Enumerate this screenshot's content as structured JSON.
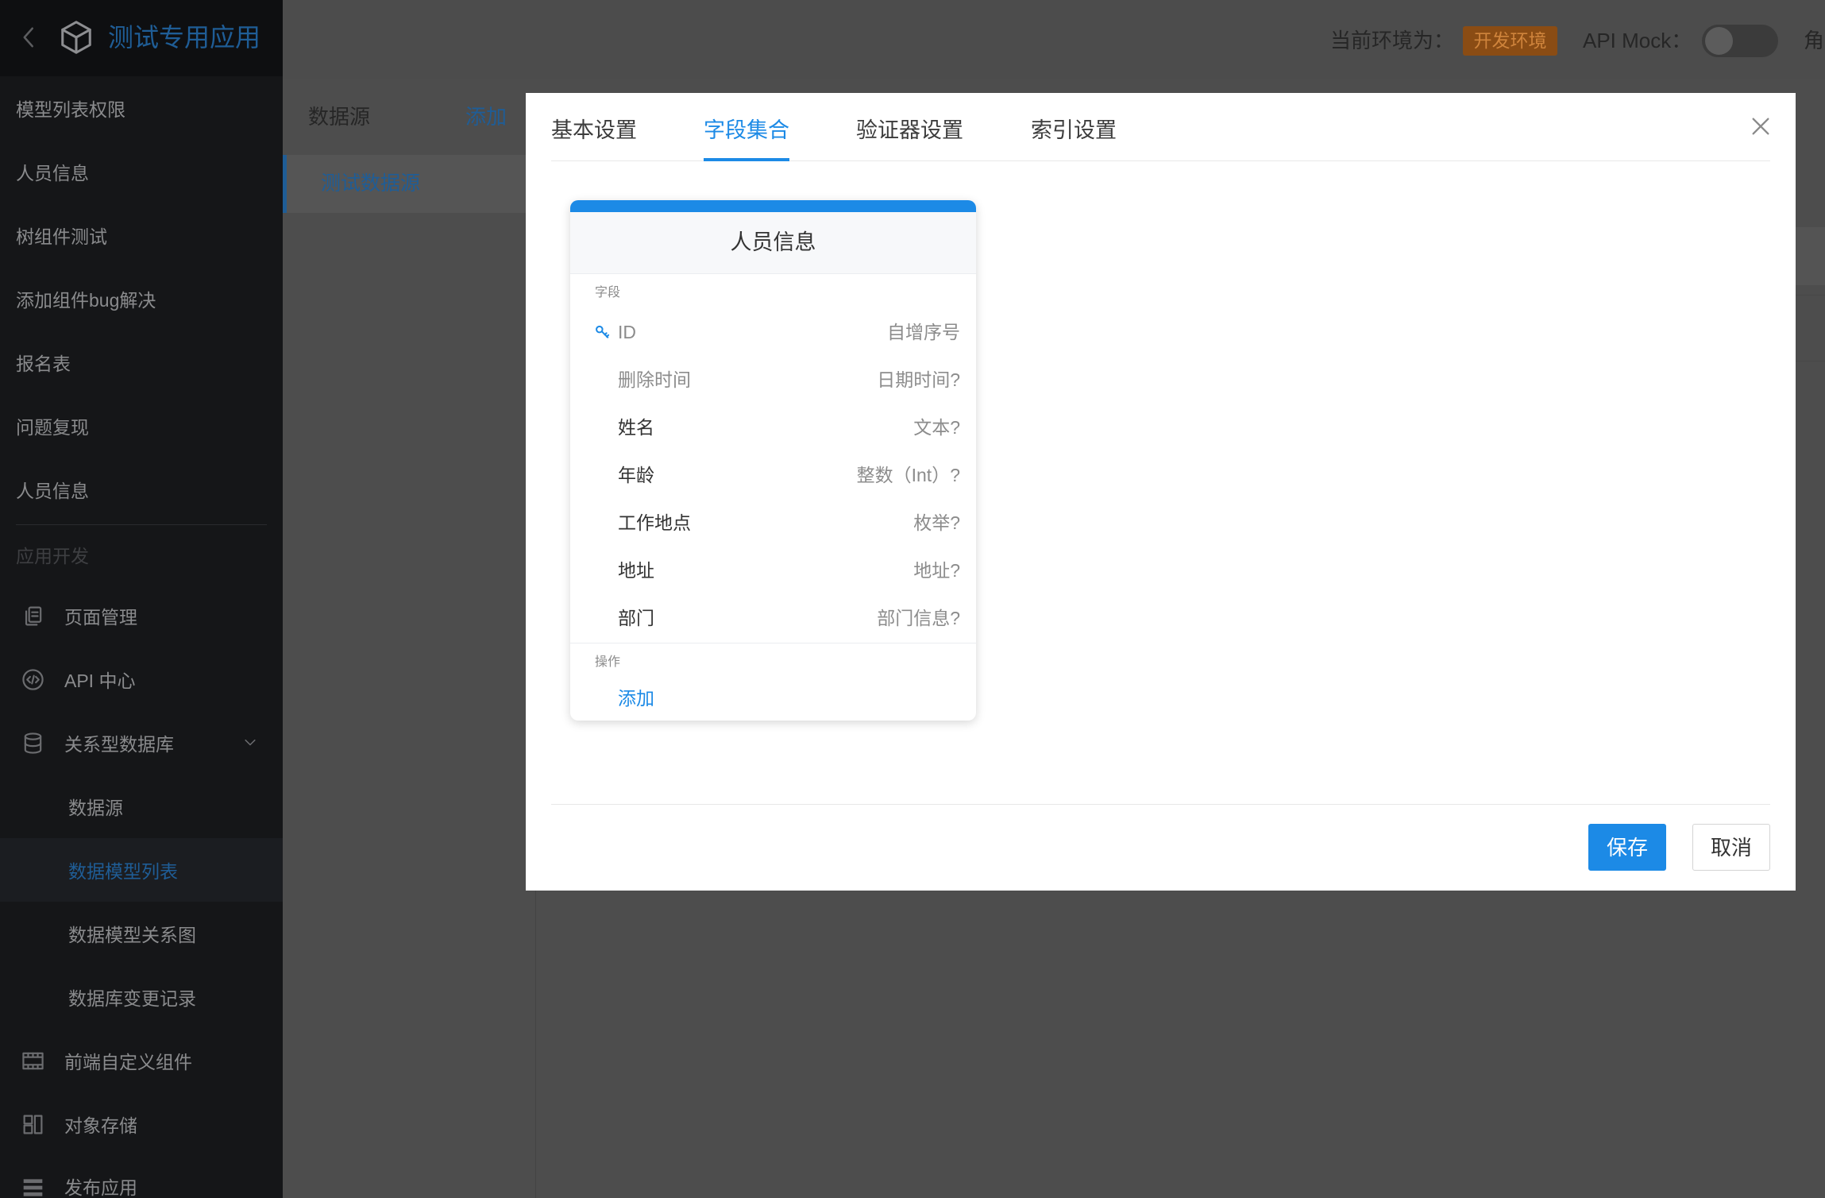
{
  "sidebar": {
    "back_icon": "chevron-left-icon",
    "app_icon": "cube-icon",
    "app_name": "测试专用应用",
    "models": [
      {
        "label": "模型列表权限"
      },
      {
        "label": "人员信息"
      },
      {
        "label": "树组件测试"
      },
      {
        "label": "添加组件bug解决"
      },
      {
        "label": "报名表"
      },
      {
        "label": "问题复现"
      },
      {
        "label": "人员信息"
      }
    ],
    "section_title": "应用开发",
    "dev_items": [
      {
        "label": "页面管理",
        "icon": "pages-icon"
      },
      {
        "label": "API 中心",
        "icon": "api-icon"
      },
      {
        "label": "关系型数据库",
        "icon": "database-icon",
        "expanded": true,
        "children": [
          {
            "label": "数据源"
          },
          {
            "label": "数据模型列表",
            "active": true
          },
          {
            "label": "数据模型关系图"
          },
          {
            "label": "数据库变更记录"
          }
        ]
      },
      {
        "label": "前端自定义组件",
        "icon": "component-icon"
      },
      {
        "label": "对象存储",
        "icon": "object-storage-icon"
      },
      {
        "label": "发布应用",
        "icon": "publish-icon"
      }
    ]
  },
  "header": {
    "env_label": "当前环境为：",
    "env_badge": "开发环境",
    "mock_label": "API Mock：",
    "mock_enabled": false,
    "cut_off_label": "角"
  },
  "datasource_panel": {
    "title": "数据源",
    "add_label": "添加",
    "items": [
      {
        "label": "测试数据源",
        "active": true
      }
    ]
  },
  "modal": {
    "tabs": [
      {
        "label": "基本设置",
        "active": false
      },
      {
        "label": "字段集合",
        "active": true
      },
      {
        "label": "验证器设置",
        "active": false
      },
      {
        "label": "索引设置",
        "active": false
      }
    ],
    "close_icon": "close-icon",
    "model_card": {
      "title": "人员信息",
      "fields_label": "字段",
      "fields": [
        {
          "name": "ID",
          "type": "自增序号",
          "primary_key": true,
          "system": true
        },
        {
          "name": "删除时间",
          "type": "日期时间?",
          "system": true
        },
        {
          "name": "姓名",
          "type": "文本?"
        },
        {
          "name": "年龄",
          "type": "整数（Int）?"
        },
        {
          "name": "工作地点",
          "type": "枚举?"
        },
        {
          "name": "地址",
          "type": "地址?"
        },
        {
          "name": "部门",
          "type": "部门信息?"
        }
      ],
      "actions_label": "操作",
      "add_label": "添加"
    },
    "save_label": "保存",
    "cancel_label": "取消"
  },
  "colors": {
    "accent": "#1c8ae6",
    "sidebar_accent_dimmed": "#1f5d96",
    "env_badge_bg": "#8a4c14",
    "env_badge_text": "#cf843c"
  }
}
